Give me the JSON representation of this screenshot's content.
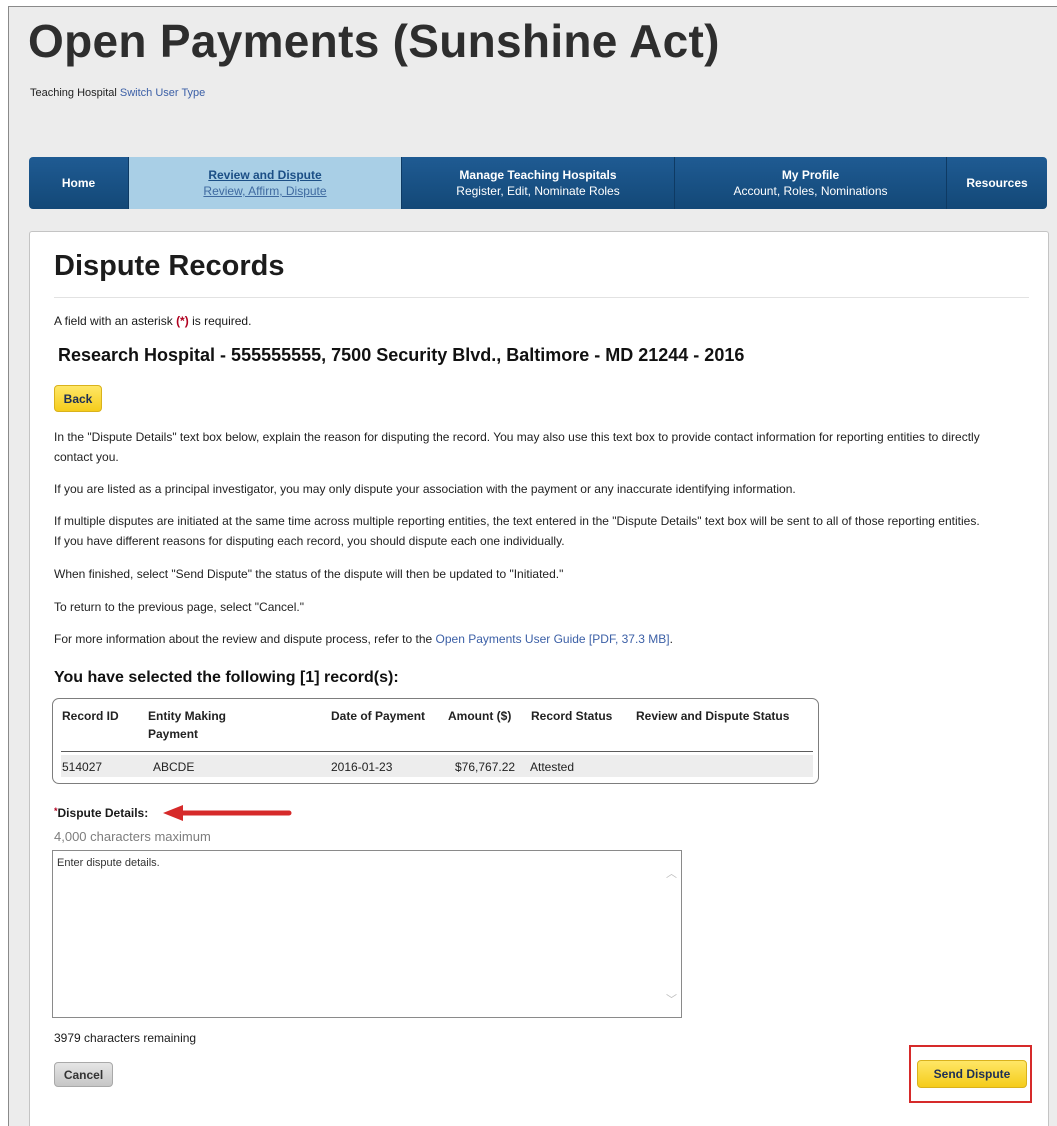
{
  "header": {
    "title": "Open Payments (Sunshine Act)",
    "user_type": "Teaching Hospital",
    "switch_link": "Switch User Type"
  },
  "nav": {
    "home": "Home",
    "review_title": "Review and Dispute",
    "review_sub": "Review, Affirm, Dispute",
    "manage_title": "Manage Teaching Hospitals",
    "manage_sub": "Register, Edit, Nominate Roles",
    "profile_title": "My Profile",
    "profile_sub": "Account, Roles, Nominations",
    "resources": "Resources"
  },
  "page": {
    "heading": "Dispute Records",
    "required_note_pre": "A field with an asterisk ",
    "required_note_mark": "(*)",
    "required_note_post": " is required.",
    "hospital_line": "Research Hospital - 555555555, 7500 Security Blvd., Baltimore - MD 21244 - 2016",
    "back_button": "Back",
    "para1": "In the \"Dispute Details\" text box below, explain the reason for disputing the record. You may also use this text box to provide contact information for reporting entities to directly contact you.",
    "para2": "If you are listed as a principal investigator, you may only dispute your association with the payment or any inaccurate identifying information.",
    "para3": "If multiple disputes are initiated at the same time across multiple reporting entities, the text entered in the \"Dispute Details\" text box will be sent to all of those reporting entities. If you have different reasons for disputing each record, you should dispute each one individually.",
    "para4": "When finished, select \"Send Dispute\" the status of the dispute will then be updated to \"Initiated.\"",
    "para5": "To return to the previous page, select \"Cancel.\"",
    "para6_pre": "For more information about the review and dispute process, refer to the ",
    "para6_link": "Open Payments User Guide [PDF, 37.3 MB]",
    "para6_post": ".",
    "selected_heading": "You have selected the following [1] record(s):"
  },
  "records": {
    "headers": [
      "Record ID",
      "Entity Making Payment",
      "Date of Payment",
      "Amount ($)",
      "Record Status",
      "Review and Dispute Status"
    ],
    "rows": [
      {
        "record_id": "514027",
        "entity": "ABCDE",
        "date": "2016-01-23",
        "amount": "$76,767.22",
        "status": "Attested",
        "dispute_status": ""
      }
    ]
  },
  "dispute": {
    "label": "Dispute Details:",
    "required_mark": "*",
    "max_note": "4,000 characters maximum",
    "placeholder": "Enter dispute details.",
    "remaining": "3979 characters remaining"
  },
  "actions": {
    "cancel": "Cancel",
    "send": "Send Dispute"
  },
  "colors": {
    "nav_bg": "#1f5b93",
    "nav_active_bg": "#a9cfe6",
    "button_yellow": "#f5cc1b",
    "annotation_red": "#d62a2a",
    "link": "#3b5fa6"
  }
}
